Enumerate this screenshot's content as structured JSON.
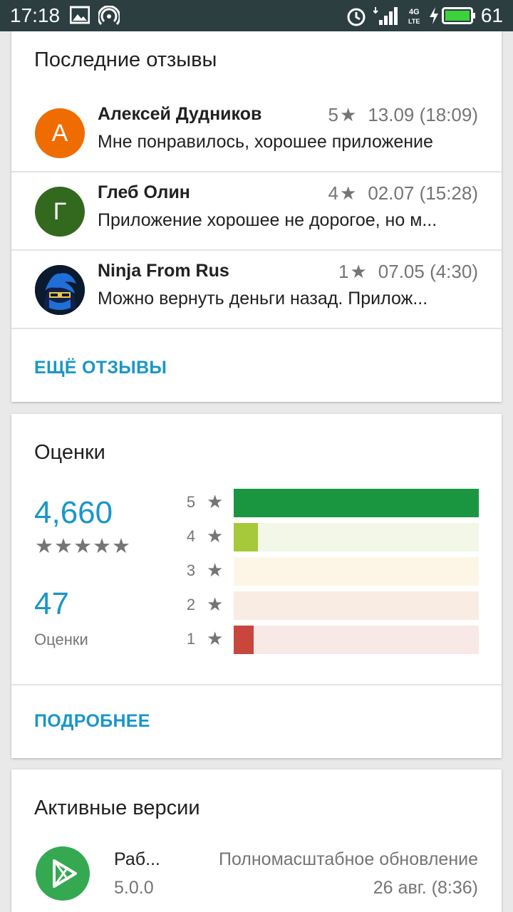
{
  "status_bar": {
    "time": "17:18",
    "battery": "61"
  },
  "reviews": {
    "title": "Последние отзывы",
    "items": [
      {
        "initial": "А",
        "avatar_color": "#ef6c00",
        "name": "Алексей Дудников",
        "rating": "5",
        "date": "13.09 (18:09)",
        "text": "Мне понравилось, хорошее приложение"
      },
      {
        "initial": "Г",
        "avatar_color": "#33691e",
        "name": "Глеб Олин",
        "rating": "4",
        "date": "02.07 (15:28)",
        "text": "Приложение хорошее не дорогое, но м..."
      },
      {
        "initial": "",
        "avatar_color": "#0b1a2e",
        "name": "Ninja From Rus",
        "rating": "1",
        "date": "07.05 (4:30)",
        "text": "Можно вернуть деньги назад. Прилож..."
      }
    ],
    "more_label": "ЕЩЁ ОТЗЫВЫ"
  },
  "ratings": {
    "title": "Оценки",
    "average": "4,660",
    "stars": "★★★★★",
    "count": "47",
    "count_label": "Оценки",
    "more_label": "ПОДРОБНЕЕ",
    "bars": [
      {
        "label": "5",
        "fraction": 1.0,
        "color": "#1a9641",
        "track": "#1a9641"
      },
      {
        "label": "4",
        "fraction": 0.1,
        "color": "#a6c93b",
        "track": "#f2f7e8"
      },
      {
        "label": "3",
        "fraction": 0.0,
        "color": "#f5d97a",
        "track": "#fdf6e6"
      },
      {
        "label": "2",
        "fraction": 0.0,
        "color": "#f0b37a",
        "track": "#f9ece3"
      },
      {
        "label": "1",
        "fraction": 0.08,
        "color": "#c9463d",
        "track": "#f8e8e6"
      }
    ]
  },
  "versions": {
    "title": "Активные версии",
    "name": "Раб...",
    "number": "5.0.0",
    "type": "Полномасштабное обновление",
    "date": "26 авг. (8:36)"
  }
}
